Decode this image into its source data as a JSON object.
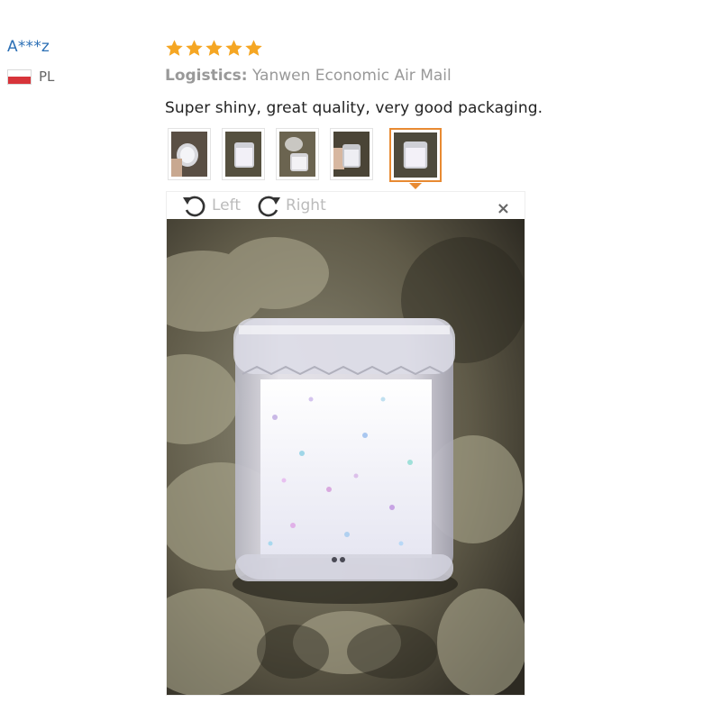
{
  "reviewer": {
    "name": "A***z",
    "country_code": "PL"
  },
  "review": {
    "stars": 5,
    "logistics_label": "Logistics:",
    "logistics_value": "Yanwen Economic Air Mail",
    "text": "Super shiny, great quality, very good packaging."
  },
  "viewer": {
    "rotate_left_label": "Left",
    "rotate_right_label": "Right",
    "close_label": "×"
  },
  "colors": {
    "star": "#f5a623",
    "accent": "#e88a32",
    "name_link": "#2b6fb5"
  }
}
